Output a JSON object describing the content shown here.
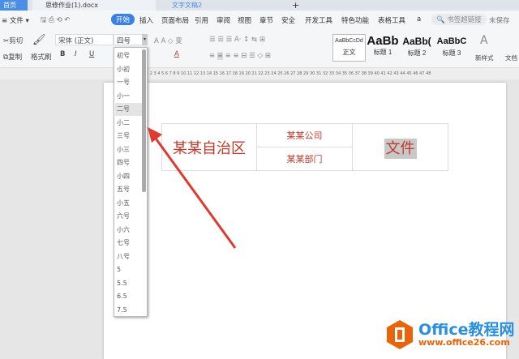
{
  "tabs": [
    {
      "label": "首页",
      "active": true
    },
    {
      "label": "思修作业(1).docx"
    },
    {
      "label": "文字文稿2"
    }
  ],
  "new_tab": "+",
  "file_menu": "文件",
  "menu": [
    "开始",
    "插入",
    "页面布局",
    "引用",
    "审阅",
    "视图",
    "章节",
    "安全",
    "开发工具",
    "特色功能",
    "表格工具",
    "a"
  ],
  "search_placeholder": "书签超链接",
  "unsaved": "未保存",
  "toolbar": {
    "cut": "剪切",
    "copy": "复制",
    "format_painter": "格式刷",
    "font": "宋体 (正文)",
    "size": "四号",
    "bold": "B",
    "italic": "I",
    "underline": "U",
    "font_color": "A",
    "new_style": "新样式",
    "doc_helper": "文档"
  },
  "styles": [
    {
      "preview": "AaBbCcDd",
      "label": "正文"
    },
    {
      "preview": "AaBb",
      "label": "标题 1"
    },
    {
      "preview": "AaBb(",
      "label": "标题 2"
    },
    {
      "preview": "AaBbC",
      "label": "标题 3"
    }
  ],
  "ruler": "1 2 3 4 5 6 7 8 9 10 11 12 13 14 15 16 17 18 19 20 21 22 23 24 25 26 27 28 29 30 31 32 33 34 35 36 37 38 39 40 41 42 43 44 45 46 47 48",
  "font_sizes": [
    "初号",
    "小初",
    "一号",
    "小一",
    "二号",
    "小二",
    "三号",
    "小三",
    "四号",
    "小四",
    "五号",
    "小五",
    "六号",
    "小六",
    "七号",
    "八号",
    "5",
    "5.5",
    "6.5",
    "7.5"
  ],
  "selected_size_index": 4,
  "table": {
    "region": "某某自治区",
    "company": "某某公司",
    "department": "某某部门",
    "file": "文件"
  },
  "watermark": {
    "title": "Office教程网",
    "url": "www.office26.com"
  },
  "colors": {
    "accent": "#2b7de9",
    "red": "#c0392b",
    "logo": "#e8630a"
  }
}
